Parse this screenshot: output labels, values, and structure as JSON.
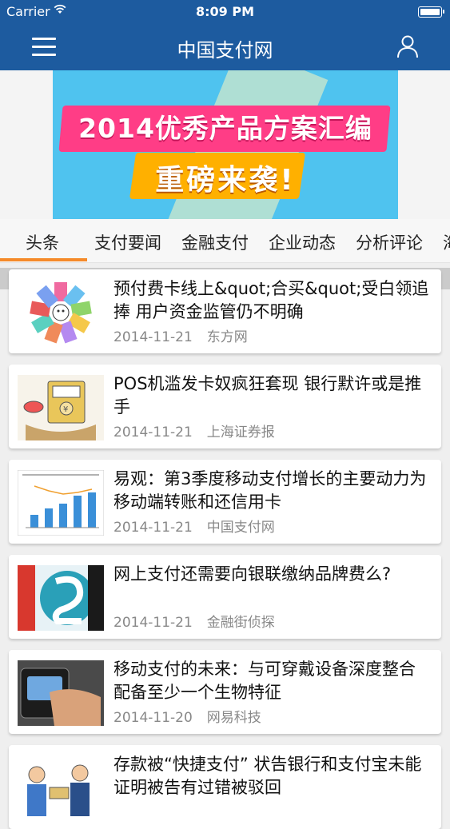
{
  "status_bar": {
    "carrier": "Carrier",
    "time": "8:09 PM"
  },
  "nav": {
    "title": "中国支付网"
  },
  "banner": {
    "line1": "2014优秀产品方案汇编",
    "line2": "重磅来袭!",
    "active_index": 0,
    "slide_count": 3
  },
  "tabs": [
    "头条",
    "支付要闻",
    "金融支付",
    "企业动态",
    "分析评论",
    "海"
  ],
  "articles": [
    {
      "title": "预付费卡线上&quot;合买&quot;受白领追捧 用户资金监管仍不明确",
      "date": "2014-11-21",
      "source": "东方网"
    },
    {
      "title": "POS机滥发卡奴疯狂套现 银行默许或是推手",
      "date": "2014-11-21",
      "source": "上海证券报"
    },
    {
      "title": "易观：第3季度移动支付增长的主要动力为移动端转账和还信用卡",
      "date": "2014-11-21",
      "source": "中国支付网"
    },
    {
      "title": "网上支付还需要向银联缴纳品牌费么?",
      "date": "2014-11-21",
      "source": "金融街侦探"
    },
    {
      "title": "移动支付的未来：与可穿戴设备深度整合 配备至少一个生物特征",
      "date": "2014-11-20",
      "source": "网易科技"
    },
    {
      "title": "存款被“快捷支付” 状告银行和支付宝未能证明被告有过错被驳回",
      "date": "",
      "source": ""
    }
  ],
  "colors": {
    "brand": "#1d5b9f",
    "tab_accent": "#f58a2a",
    "banner_bg": "#4fc3ef",
    "banner_pink": "#ff3d86",
    "banner_orange": "#ffb000"
  }
}
